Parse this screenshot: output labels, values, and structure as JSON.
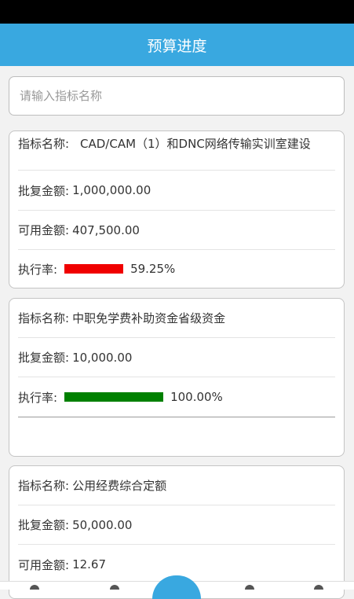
{
  "header": {
    "title": "预算进度"
  },
  "search": {
    "placeholder": "请输入指标名称"
  },
  "cards": [
    {
      "name_label": "指标名称:",
      "name_value": "CAD/CAM（1）和DNC网络传输实训室建设",
      "approved_label": "批复金额:",
      "approved_value": "1,000,000.00",
      "available_label": "可用金额:",
      "available_value": "407,500.00",
      "rate_label": "执行率:",
      "rate_value": "59.25%",
      "rate": 0.5925,
      "bar_color": "#f00000"
    },
    {
      "name_label": "指标名称:",
      "name_value": "中职免学费补助资金省级资金",
      "approved_label": "批复金额:",
      "approved_value": "10,000.00",
      "rate_label": "执行率:",
      "rate_value": "100.00%",
      "rate": 1.0,
      "bar_color": "#008000"
    },
    {
      "name_label": "指标名称:",
      "name_value": "公用经费综合定额",
      "approved_label": "批复金额:",
      "approved_value": "50,000.00",
      "available_label": "可用金额:",
      "available_value": "12.67"
    }
  ],
  "colors": {
    "header": "#39a8e0"
  }
}
